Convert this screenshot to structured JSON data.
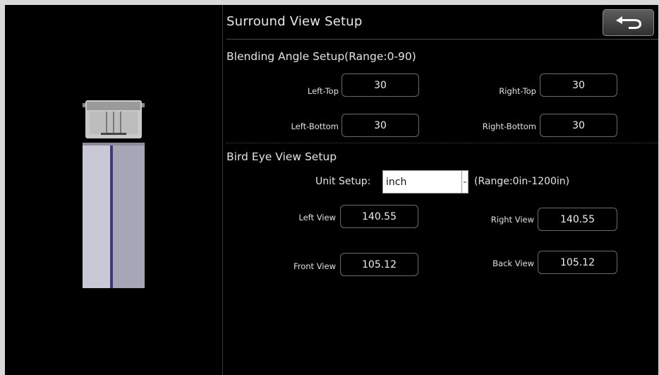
{
  "header": {
    "title": "Surround View Setup",
    "back_icon": "back-arrow-icon"
  },
  "blending": {
    "heading": "Blending Angle Setup(Range:0-90)",
    "left_top": {
      "label": "Left-Top",
      "value": "30"
    },
    "right_top": {
      "label": "Right-Top",
      "value": "30"
    },
    "left_bottom": {
      "label": "Left-Bottom",
      "value": "30"
    },
    "right_bottom": {
      "label": "Right-Bottom",
      "value": "30"
    }
  },
  "bird_eye": {
    "heading": "Bird Eye View Setup",
    "unit_label": "Unit Setup:",
    "unit_value": "inch",
    "range_note": "(Range:0in-1200in)",
    "left_view": {
      "label": "Left View",
      "value": "140.55"
    },
    "right_view": {
      "label": "Right View",
      "value": "140.55"
    },
    "front_view": {
      "label": "Front View",
      "value": "105.12"
    },
    "back_view": {
      "label": "Back View",
      "value": "105.12"
    }
  },
  "colors": {
    "background": "#000000",
    "text": "#e8e8e8",
    "field_border": "#6a6a6a"
  }
}
